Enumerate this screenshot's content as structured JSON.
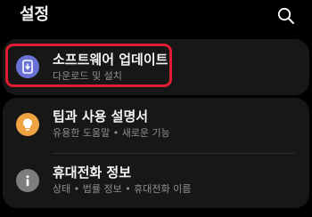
{
  "header": {
    "title": "설정",
    "search_icon": "search-icon"
  },
  "items": [
    {
      "title": "소프트웨어 업데이트",
      "subtitle": "다운로드 및 설치",
      "icon": "software-update-icon",
      "icon_color": "#6b72d6"
    },
    {
      "title": "팁과 사용 설명서",
      "subtitle": "유용한 도움말 • 새로운 기능",
      "icon": "lightbulb-icon",
      "icon_color": "#f0a341"
    },
    {
      "title": "휴대전화 정보",
      "subtitle": "상태 • 법률 정보 • 휴대전화 이름",
      "icon": "info-icon",
      "icon_color": "#7d7d7d"
    }
  ],
  "colors": {
    "background": "#000000",
    "card": "#171717",
    "highlight": "#e21d33"
  }
}
